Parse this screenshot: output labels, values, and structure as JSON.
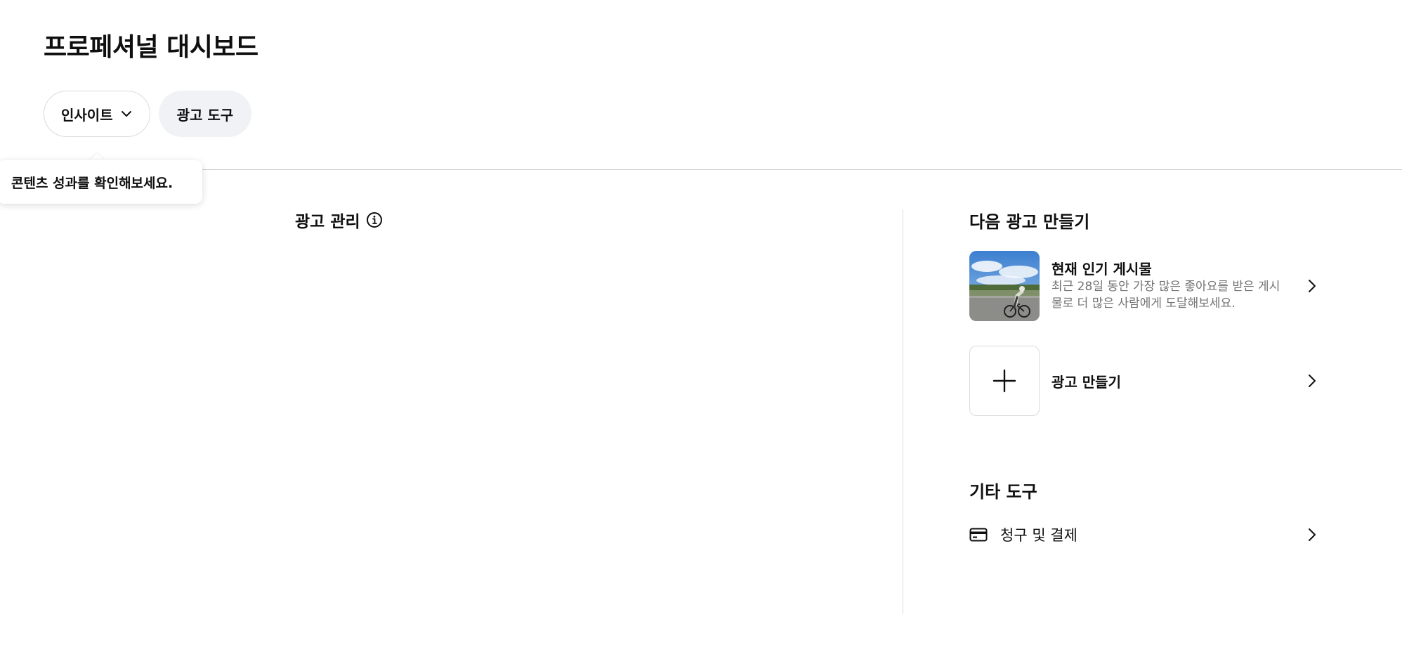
{
  "page": {
    "title": "프로페셔널 대시보드"
  },
  "tabs": [
    {
      "label": "인사이트",
      "icon": "chevron-down-icon"
    },
    {
      "label": "광고 도구"
    }
  ],
  "tooltip": {
    "text": "콘텐츠 성과를 확인해보세요."
  },
  "ad_management": {
    "heading": "광고 관리",
    "icon": "info-icon"
  },
  "next_ad": {
    "heading": "다음 광고 만들기",
    "items": [
      {
        "title": "현재 인기 게시물",
        "description": "최근 28일 동안 가장 많은 좋아요를 받은 게시물로 더 많은 사람에게 도달해보세요.",
        "thumbnail": "cyclist-photo"
      },
      {
        "title": "광고 만들기",
        "icon": "plus-icon"
      }
    ]
  },
  "other_tools": {
    "heading": "기타 도구",
    "items": [
      {
        "label": "청구 및 결제",
        "icon": "credit-card-icon"
      }
    ]
  },
  "colors": {
    "text_primary": "#0f0f0f",
    "text_secondary": "#737373",
    "pill_bg": "#f0f2f5",
    "border": "#dbdbdb"
  }
}
